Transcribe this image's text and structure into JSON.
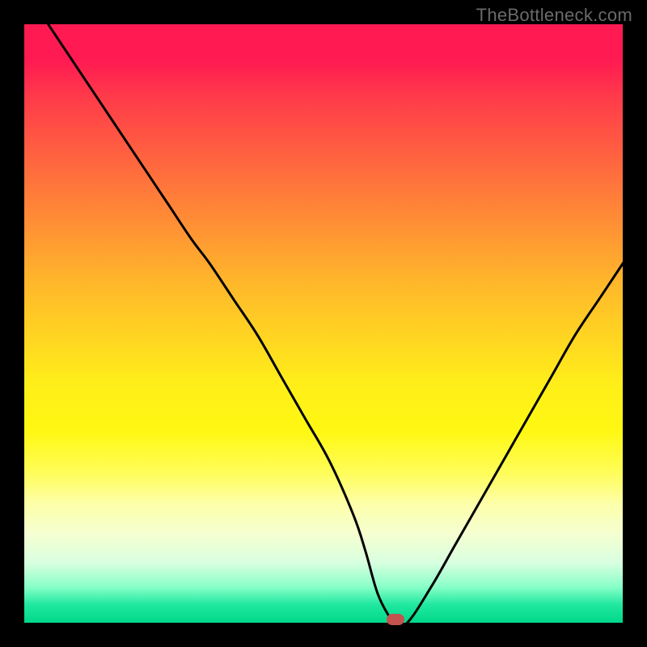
{
  "watermark": "TheBottleneck.com",
  "colors": {
    "frame": "#000000",
    "curve": "#000000",
    "marker": "#c4524e",
    "gradient_top": "#ff1a52",
    "gradient_bottom": "#00d88a"
  },
  "chart_data": {
    "type": "line",
    "title": "",
    "xlabel": "",
    "ylabel": "",
    "xlim": [
      0,
      100
    ],
    "ylim": [
      0,
      100
    ],
    "grid": false,
    "legend": false,
    "series": [
      {
        "name": "bottleneck-curve",
        "x": [
          4,
          8,
          12,
          16,
          20,
          24,
          28,
          31,
          35,
          39,
          43,
          47,
          51,
          55,
          57,
          59,
          61,
          62,
          64,
          68,
          72,
          76,
          80,
          84,
          88,
          92,
          96,
          100
        ],
        "y": [
          100,
          94,
          88,
          82,
          76,
          70,
          64,
          60,
          54,
          48,
          41,
          34,
          27,
          18,
          12,
          5,
          1,
          0,
          0,
          6,
          13,
          20,
          27,
          34,
          41,
          48,
          54,
          60
        ]
      }
    ],
    "annotations": [
      {
        "name": "optimal-marker",
        "x": 62,
        "y": 0.5,
        "shape": "pill"
      }
    ],
    "background_gradient": {
      "orientation": "vertical",
      "stops": [
        {
          "pos": 0.0,
          "color": "#ff1a52"
        },
        {
          "pos": 0.5,
          "color": "#ffe81a"
        },
        {
          "pos": 0.85,
          "color": "#f6ffd0"
        },
        {
          "pos": 1.0,
          "color": "#00d88a"
        }
      ]
    }
  }
}
